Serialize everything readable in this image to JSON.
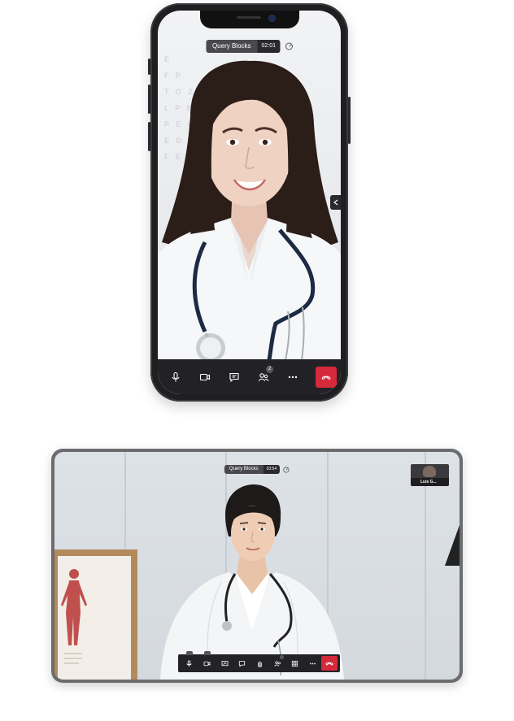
{
  "phone": {
    "meeting_title": "Query Blocks",
    "timer": "02:01",
    "eye_chart_rows": [
      "E",
      "F P",
      "T O Z",
      "L P E D",
      "P E C F D",
      "E D F C Z P",
      "F E L O P Z D"
    ],
    "toolbar": {
      "mic_icon": "microphone-icon",
      "camera_icon": "video-camera-icon",
      "chat_icon": "chat-icon",
      "participants_icon": "participants-icon",
      "participants_count": "2",
      "more_icon": "more-icon",
      "end_icon": "end-call-icon",
      "end_color": "#d42a3b"
    }
  },
  "tablet": {
    "meeting_title": "Query Blocks",
    "timer": "03:54",
    "thumbnail_name": "Luis G...",
    "toolbar": {
      "icons": [
        "microphone-icon",
        "video-camera-icon",
        "screen-share-icon",
        "chat-icon",
        "raise-hand-icon",
        "participants-icon",
        "grid-view-icon",
        "more-icon"
      ],
      "end_icon": "end-call-icon",
      "end_color": "#d42a3b"
    }
  }
}
